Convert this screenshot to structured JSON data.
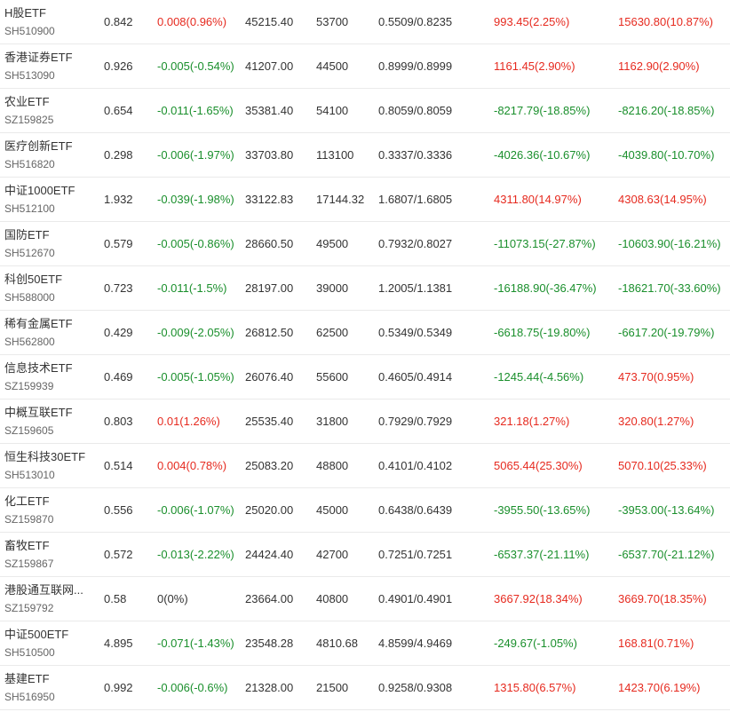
{
  "colors": {
    "up": "#e62a1f",
    "down": "#1a8f2c",
    "neutral": "#333333"
  },
  "rows": [
    {
      "name": "H股ETF",
      "code": "SH510900",
      "price": "0.842",
      "change": "0.008(0.96%)",
      "change_dir": "up",
      "amount": "45215.40",
      "volume": "53700",
      "nav": "0.5509/0.8235",
      "f1": "993.45(2.25%)",
      "f1_dir": "up",
      "f2": "15630.80(10.87%)",
      "f2_dir": "up"
    },
    {
      "name": "香港证券ETF",
      "code": "SH513090",
      "price": "0.926",
      "change": "-0.005(-0.54%)",
      "change_dir": "down",
      "amount": "41207.00",
      "volume": "44500",
      "nav": "0.8999/0.8999",
      "f1": "1161.45(2.90%)",
      "f1_dir": "up",
      "f2": "1162.90(2.90%)",
      "f2_dir": "up"
    },
    {
      "name": "农业ETF",
      "code": "SZ159825",
      "price": "0.654",
      "change": "-0.011(-1.65%)",
      "change_dir": "down",
      "amount": "35381.40",
      "volume": "54100",
      "nav": "0.8059/0.8059",
      "f1": "-8217.79(-18.85%)",
      "f1_dir": "down",
      "f2": "-8216.20(-18.85%)",
      "f2_dir": "down"
    },
    {
      "name": "医疗创新ETF",
      "code": "SH516820",
      "price": "0.298",
      "change": "-0.006(-1.97%)",
      "change_dir": "down",
      "amount": "33703.80",
      "volume": "113100",
      "nav": "0.3337/0.3336",
      "f1": "-4026.36(-10.67%)",
      "f1_dir": "down",
      "f2": "-4039.80(-10.70%)",
      "f2_dir": "down"
    },
    {
      "name": "中证1000ETF",
      "code": "SH512100",
      "price": "1.932",
      "change": "-0.039(-1.98%)",
      "change_dir": "down",
      "amount": "33122.83",
      "volume": "17144.32",
      "nav": "1.6807/1.6805",
      "f1": "4311.80(14.97%)",
      "f1_dir": "up",
      "f2": "4308.63(14.95%)",
      "f2_dir": "up"
    },
    {
      "name": "国防ETF",
      "code": "SH512670",
      "price": "0.579",
      "change": "-0.005(-0.86%)",
      "change_dir": "down",
      "amount": "28660.50",
      "volume": "49500",
      "nav": "0.7932/0.8027",
      "f1": "-11073.15(-27.87%)",
      "f1_dir": "down",
      "f2": "-10603.90(-16.21%)",
      "f2_dir": "down"
    },
    {
      "name": "科创50ETF",
      "code": "SH588000",
      "price": "0.723",
      "change": "-0.011(-1.5%)",
      "change_dir": "down",
      "amount": "28197.00",
      "volume": "39000",
      "nav": "1.2005/1.1381",
      "f1": "-16188.90(-36.47%)",
      "f1_dir": "down",
      "f2": "-18621.70(-33.60%)",
      "f2_dir": "down"
    },
    {
      "name": "稀有金属ETF",
      "code": "SH562800",
      "price": "0.429",
      "change": "-0.009(-2.05%)",
      "change_dir": "down",
      "amount": "26812.50",
      "volume": "62500",
      "nav": "0.5349/0.5349",
      "f1": "-6618.75(-19.80%)",
      "f1_dir": "down",
      "f2": "-6617.20(-19.79%)",
      "f2_dir": "down"
    },
    {
      "name": "信息技术ETF",
      "code": "SZ159939",
      "price": "0.469",
      "change": "-0.005(-1.05%)",
      "change_dir": "down",
      "amount": "26076.40",
      "volume": "55600",
      "nav": "0.4605/0.4914",
      "f1": "-1245.44(-4.56%)",
      "f1_dir": "down",
      "f2": "473.70(0.95%)",
      "f2_dir": "up"
    },
    {
      "name": "中概互联ETF",
      "code": "SZ159605",
      "price": "0.803",
      "change": "0.01(1.26%)",
      "change_dir": "up",
      "amount": "25535.40",
      "volume": "31800",
      "nav": "0.7929/0.7929",
      "f1": "321.18(1.27%)",
      "f1_dir": "up",
      "f2": "320.80(1.27%)",
      "f2_dir": "up"
    },
    {
      "name": "恒生科技30ETF",
      "code": "SH513010",
      "price": "0.514",
      "change": "0.004(0.78%)",
      "change_dir": "up",
      "amount": "25083.20",
      "volume": "48800",
      "nav": "0.4101/0.4102",
      "f1": "5065.44(25.30%)",
      "f1_dir": "up",
      "f2": "5070.10(25.33%)",
      "f2_dir": "up"
    },
    {
      "name": "化工ETF",
      "code": "SZ159870",
      "price": "0.556",
      "change": "-0.006(-1.07%)",
      "change_dir": "down",
      "amount": "25020.00",
      "volume": "45000",
      "nav": "0.6438/0.6439",
      "f1": "-3955.50(-13.65%)",
      "f1_dir": "down",
      "f2": "-3953.00(-13.64%)",
      "f2_dir": "down"
    },
    {
      "name": "畜牧ETF",
      "code": "SZ159867",
      "price": "0.572",
      "change": "-0.013(-2.22%)",
      "change_dir": "down",
      "amount": "24424.40",
      "volume": "42700",
      "nav": "0.7251/0.7251",
      "f1": "-6537.37(-21.11%)",
      "f1_dir": "down",
      "f2": "-6537.70(-21.12%)",
      "f2_dir": "down"
    },
    {
      "name": "港股通互联网...",
      "code": "SZ159792",
      "price": "0.58",
      "change": "0(0%)",
      "change_dir": "neutral",
      "amount": "23664.00",
      "volume": "40800",
      "nav": "0.4901/0.4901",
      "f1": "3667.92(18.34%)",
      "f1_dir": "up",
      "f2": "3669.70(18.35%)",
      "f2_dir": "up"
    },
    {
      "name": "中证500ETF",
      "code": "SH510500",
      "price": "4.895",
      "change": "-0.071(-1.43%)",
      "change_dir": "down",
      "amount": "23548.28",
      "volume": "4810.68",
      "nav": "4.8599/4.9469",
      "f1": "-249.67(-1.05%)",
      "f1_dir": "down",
      "f2": "168.81(0.71%)",
      "f2_dir": "up"
    },
    {
      "name": "基建ETF",
      "code": "SH516950",
      "price": "0.992",
      "change": "-0.006(-0.6%)",
      "change_dir": "down",
      "amount": "21328.00",
      "volume": "21500",
      "nav": "0.9258/0.9308",
      "f1": "1315.80(6.57%)",
      "f1_dir": "up",
      "f2": "1423.70(6.19%)",
      "f2_dir": "up"
    }
  ]
}
